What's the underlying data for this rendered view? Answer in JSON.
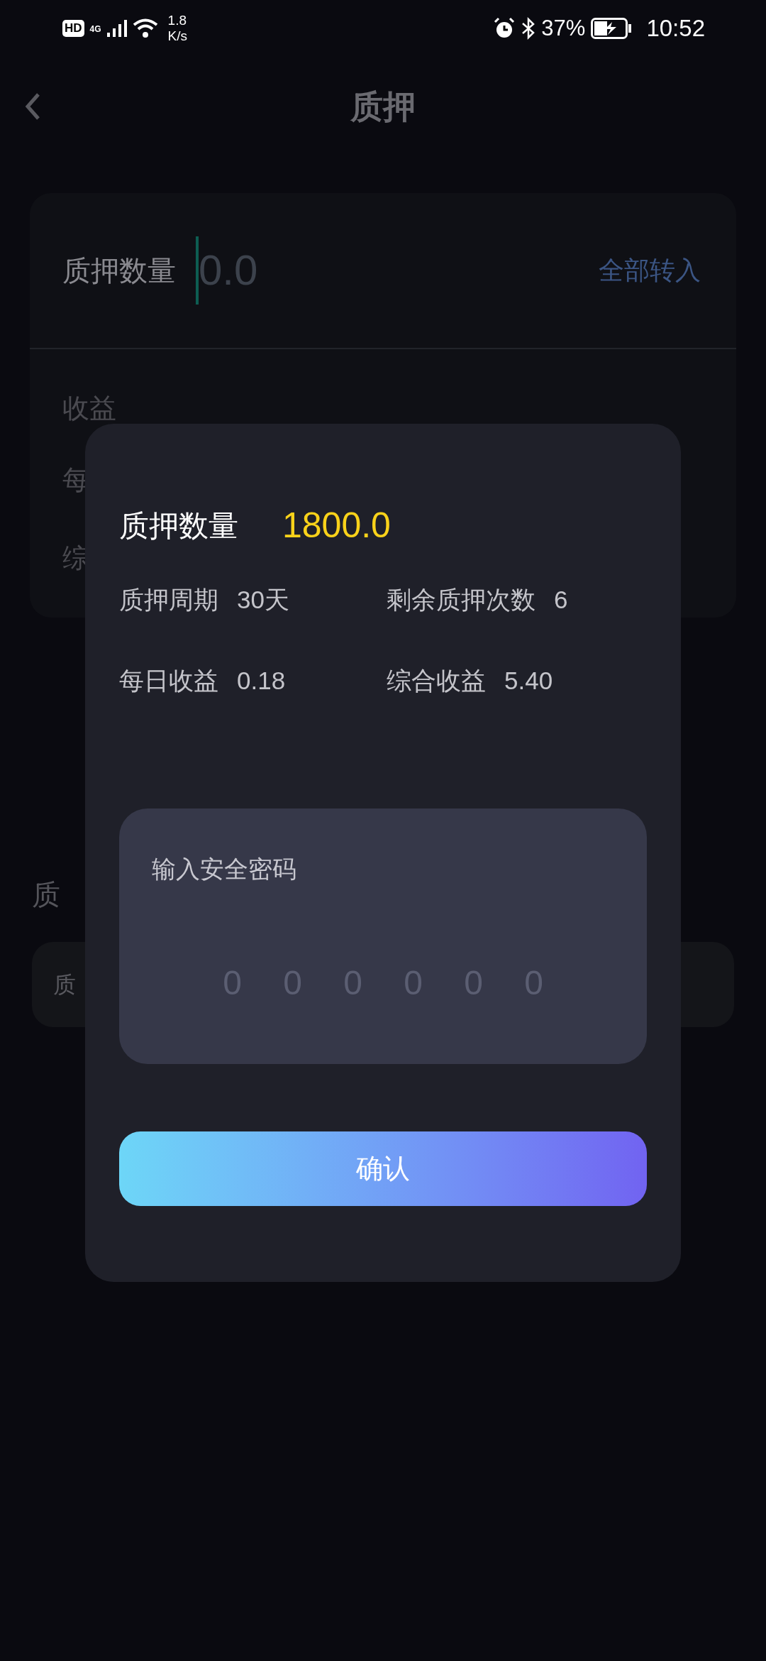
{
  "status_bar": {
    "network_badge": "HD",
    "network_type": "4G",
    "speed_value": "1.8",
    "speed_unit": "K/s",
    "battery": "37%",
    "time": "10:52"
  },
  "header": {
    "title": "质押"
  },
  "stake_card": {
    "label": "质押数量",
    "input": {
      "placeholder": "0.0",
      "focused": true
    },
    "link": "全部转入",
    "earnings_title": "收益",
    "rows": [
      "每",
      "综"
    ]
  },
  "section_heading": "质",
  "section_card_text": "质",
  "dialog": {
    "label": "质押数量",
    "amount": "1800.0",
    "details": [
      {
        "label": "质押周期",
        "value": "30天"
      },
      {
        "label": "剩余质押次数",
        "value": "6"
      },
      {
        "label": "每日收益",
        "value": "0.18"
      },
      {
        "label": "综合收益",
        "value": "5.40"
      }
    ],
    "password": {
      "label": "输入安全密码",
      "digits": [
        "0",
        "0",
        "0",
        "0",
        "0",
        "0"
      ]
    },
    "confirm": "确认"
  }
}
